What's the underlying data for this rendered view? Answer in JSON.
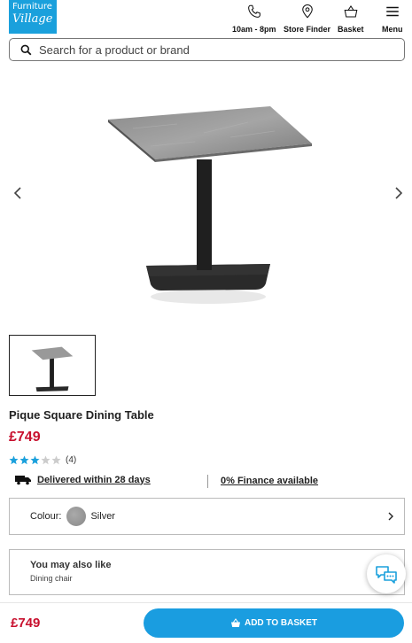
{
  "logo": {
    "line1": "Furniture",
    "line2": "Village"
  },
  "nav": {
    "hours": "10am - 8pm",
    "store_finder": "Store Finder",
    "basket": "Basket",
    "menu": "Menu"
  },
  "search": {
    "placeholder": "Search for a product or brand"
  },
  "product": {
    "title": "Pique Square Dining Table",
    "price": "£749",
    "rating": {
      "stars": 3,
      "max": 5,
      "count": "(4)"
    }
  },
  "delivery": {
    "text": "Delivered within 28 days"
  },
  "finance": {
    "text": "0% Finance available"
  },
  "colour": {
    "label": "Colour:",
    "value": "Silver"
  },
  "also_like": {
    "title": "You may also like",
    "subtitle": "Dining chair"
  },
  "bottom": {
    "price": "£749",
    "add_label": "ADD TO BASKET"
  },
  "colors": {
    "brand": "#1aa0dc",
    "price": "#c8102e",
    "star": "#1aa0dc"
  }
}
